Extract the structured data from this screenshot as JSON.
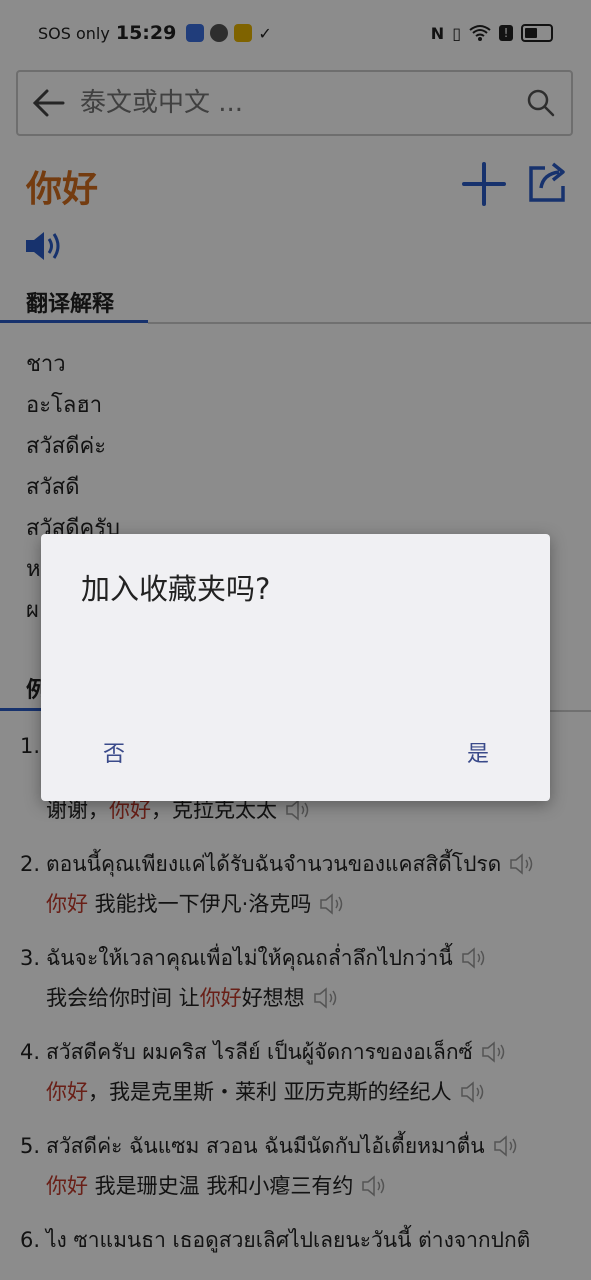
{
  "status_bar": {
    "carrier": "SOS only",
    "time": "15:29",
    "icons": [
      "shield-icon",
      "x-badge-icon",
      "app-badge-icon",
      "checklist-icon"
    ],
    "right_icons": [
      "nfc-icon",
      "vibrate-icon",
      "wifi-icon",
      "alert-icon",
      "battery-icon"
    ]
  },
  "search": {
    "placeholder": "泰文或中文 ..."
  },
  "word": {
    "title": "你好",
    "title_color": "#d46e1e"
  },
  "tabs": {
    "translation": "翻译解释",
    "examples": "例"
  },
  "translations": [
    "ชาว",
    "อะโลฮา",
    "สวัสดีค่ะ",
    "สวัสดี",
    "สวัสดีครับ",
    "ห",
    "ผ"
  ],
  "examples": [
    {
      "num": "1.",
      "th": "",
      "zh_pre": "谢谢，",
      "zh_hl": "你好",
      "zh_post": "，克拉克太太"
    },
    {
      "num": "2.",
      "th": "ตอนนี้คุณเพียงแค่ได้รับฉันจำนวนของแคสสิดี้โปรด",
      "zh_pre": "",
      "zh_hl": "你好",
      "zh_post": " 我能找一下伊凡·洛克吗"
    },
    {
      "num": "3.",
      "th": "ฉันจะให้เวลาคุณเพื่อไม่ให้คุณถล่ำลึกไปกว่านี้",
      "zh_pre": "我会给你时间 让",
      "zh_hl": "你好",
      "zh_post": "好想想"
    },
    {
      "num": "4.",
      "th": "สวัสดีครับ ผมคริส ไรลีย์ เป็นผู้จัดการของอเล็กซ์",
      "zh_pre": "",
      "zh_hl": "你好",
      "zh_post": "，我是克里斯・莱利 亚历克斯的经纪人"
    },
    {
      "num": "5.",
      "th": "สวัสดีค่ะ ฉันแซม สวอน ฉันมีนัดกับไอ้เตี้ยหมาตื่น",
      "zh_pre": "",
      "zh_hl": "你好",
      "zh_post": " 我是珊史温 我和小瘪三有约"
    },
    {
      "num": "6.",
      "th": "ไง ซาแมนธา เธอดูสวยเลิศไปเลยนะวันนี้ ต่างจากปกติ",
      "zh_pre": "",
      "zh_hl": "",
      "zh_post": ""
    }
  ],
  "dialog": {
    "title": "加入收藏夹吗?",
    "no_label": "否",
    "yes_label": "是"
  },
  "colors": {
    "accent_blue": "#2a5bc7",
    "highlight_red": "#c0392b",
    "dialog_button": "#3a4a8a"
  }
}
